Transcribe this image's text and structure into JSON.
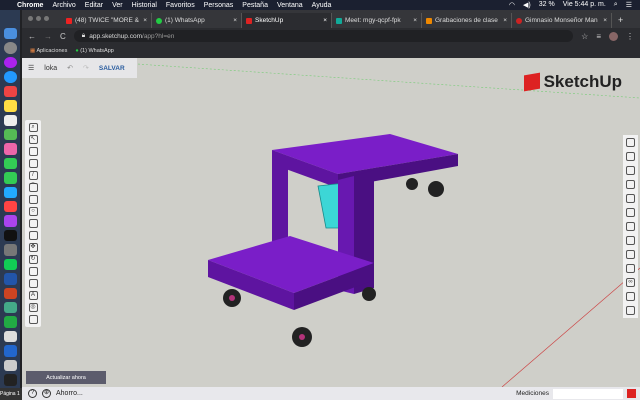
{
  "menubar": {
    "app": "Chrome",
    "items": [
      "Archivo",
      "Editar",
      "Ver",
      "Historial",
      "Favoritos",
      "Personas",
      "Pestaña",
      "Ventana",
      "Ayuda"
    ],
    "battery": "32 %",
    "clock": "Vie 5:44 p. m."
  },
  "tabs": [
    {
      "label": "(48) TWICE \"MORE &",
      "color": "#e22"
    },
    {
      "label": "(1) WhatsApp",
      "color": "#2c4"
    },
    {
      "label": "SketchUp",
      "color": "#d22",
      "active": true
    },
    {
      "label": "Meet: mgy-qcpf-fpk",
      "color": "#1a9"
    },
    {
      "label": "Grabaciones de clase",
      "color": "#e80"
    },
    {
      "label": "Gimnasio Monseñor Man",
      "color": "#c22"
    }
  ],
  "address": {
    "host": "app.sketchup.com",
    "path": "/app?hl=en"
  },
  "bookmarks": [
    "Aplicaciones",
    "(1) WhatsApp"
  ],
  "app": {
    "file_name": "loka",
    "save_label": "SALVAR",
    "logo": "SketchUp",
    "update_label": "Actualizar ahora"
  },
  "status": {
    "page": "Página 1",
    "saving": "Ahorro...",
    "measurements_label": "Mediciones",
    "measurements_value": ""
  }
}
